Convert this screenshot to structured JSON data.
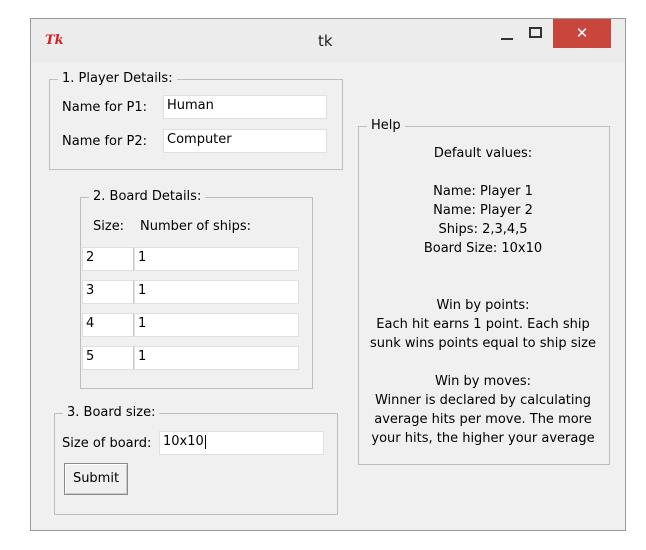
{
  "window": {
    "icon_text": "Tk",
    "title": "tk",
    "close_glyph": "✕"
  },
  "player_details": {
    "legend": "1. Player Details:",
    "p1_label": "Name for P1:",
    "p1_value": "Human",
    "p2_label": "Name for P2:",
    "p2_value": "Computer"
  },
  "board_details": {
    "legend": "2. Board Details:",
    "size_header": "Size:",
    "ships_header": "Number of ships:",
    "rows": [
      {
        "size": "2",
        "ships": "1"
      },
      {
        "size": "3",
        "ships": "1"
      },
      {
        "size": "4",
        "ships": "1"
      },
      {
        "size": "5",
        "ships": "1"
      }
    ]
  },
  "board_size": {
    "legend": "3. Board size:",
    "label": "Size of board:",
    "value": "10x10",
    "submit_label": "Submit"
  },
  "help": {
    "legend": "Help",
    "lines": [
      "Default values:",
      "",
      "Name: Player 1",
      "Name: Player 2",
      "Ships: 2,3,4,5",
      "Board Size: 10x10",
      "",
      "",
      "Win by points:",
      "Each hit earns 1 point. Each ship",
      "sunk wins points equal to ship size",
      "",
      "Win by moves:",
      "Winner is declared by calculating",
      "average hits per move. The more",
      "your hits, the higher your average"
    ]
  }
}
